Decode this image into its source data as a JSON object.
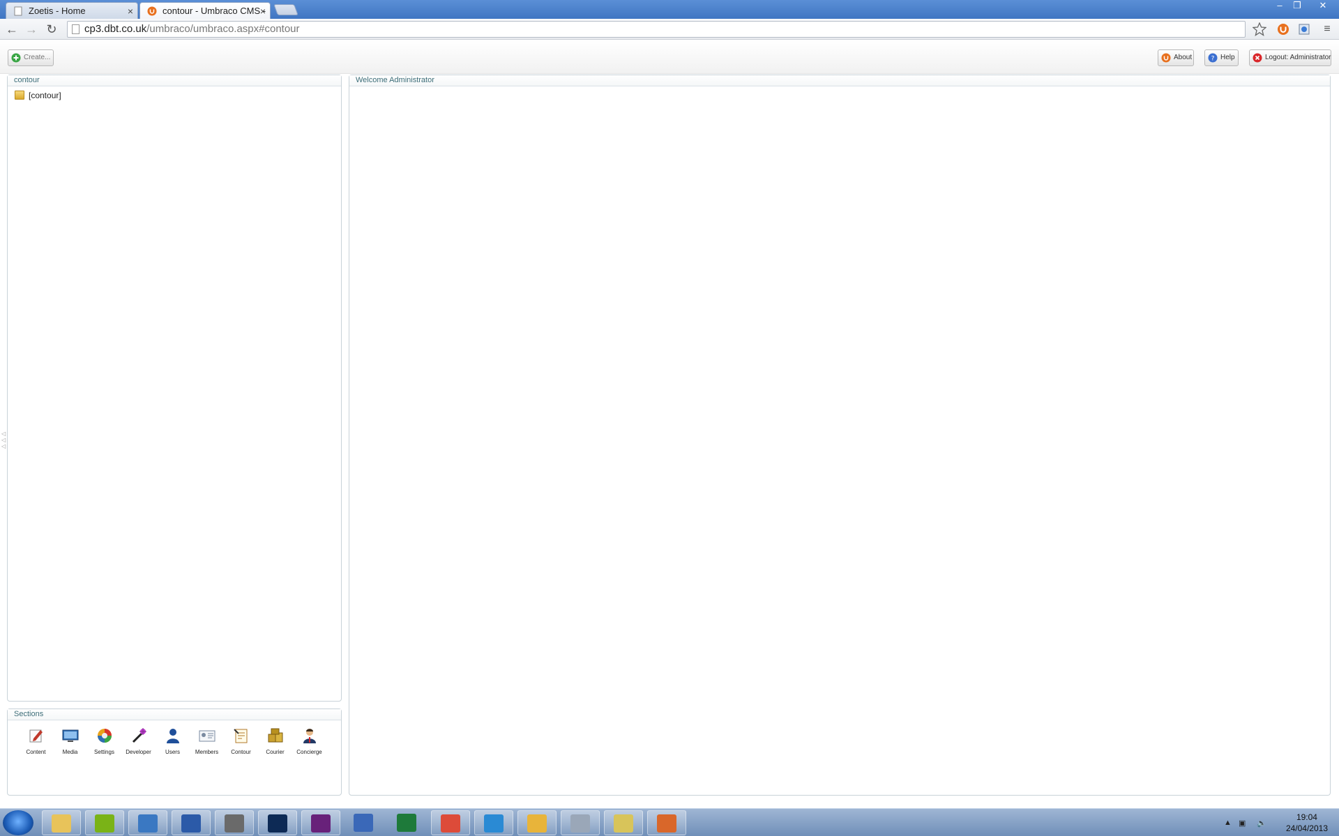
{
  "browser": {
    "tabs": [
      {
        "title": "Zoetis - Home",
        "active": false
      },
      {
        "title": "contour - Umbraco CMS -",
        "active": true
      }
    ],
    "url_host": "cp3.dbt.co.uk",
    "url_path": "/umbraco/umbraco.aspx#contour",
    "controls": {
      "minimize": "–",
      "restore": "❐",
      "close": "✕"
    }
  },
  "topbar": {
    "create_label": "Create...",
    "about_label": "About",
    "help_label": "Help",
    "logout_label": "Logout: Administrator"
  },
  "tree_panel": {
    "title": "contour",
    "nodes": [
      {
        "label": "[contour]"
      }
    ]
  },
  "sections_panel": {
    "title": "Sections",
    "items": [
      {
        "label": "Content",
        "icon": "pencil-icon",
        "color": "#c0392b"
      },
      {
        "label": "Media",
        "icon": "monitor-icon",
        "color": "#2f6fb3"
      },
      {
        "label": "Settings",
        "icon": "color-wheel-icon",
        "color": "#e8a21a"
      },
      {
        "label": "Developer",
        "icon": "wand-icon",
        "color": "#7a2f8a"
      },
      {
        "label": "Users",
        "icon": "user-icon",
        "color": "#1f4f9a"
      },
      {
        "label": "Members",
        "icon": "id-card-icon",
        "color": "#7a8aa0"
      },
      {
        "label": "Contour",
        "icon": "form-icon",
        "color": "#b07a2a"
      },
      {
        "label": "Courier",
        "icon": "boxes-icon",
        "color": "#c9a030"
      },
      {
        "label": "Concierge",
        "icon": "person-icon",
        "color": "#233a66"
      }
    ]
  },
  "main_panel": {
    "title": "Welcome Administrator"
  },
  "taskbar": {
    "time": "19:04",
    "date": "24/04/2013",
    "apps": [
      {
        "name": "explorer-icon",
        "color": "#e8c35a"
      },
      {
        "name": "spotify-icon",
        "color": "#7ab317"
      },
      {
        "name": "network-icon",
        "color": "#3a78c2"
      },
      {
        "name": "word-icon",
        "color": "#2b5aa8"
      },
      {
        "name": "archive-icon",
        "color": "#6a6a6a"
      },
      {
        "name": "photoshop-icon",
        "color": "#0d2a55"
      },
      {
        "name": "visual-studio-icon",
        "color": "#68217a"
      },
      {
        "name": "infinity-icon",
        "color": "#3a68b8"
      },
      {
        "name": "excel-icon",
        "color": "#1e7a3a"
      },
      {
        "name": "chrome-icon",
        "color": "#dd4b39"
      },
      {
        "name": "ie-icon",
        "color": "#2a8ad4"
      },
      {
        "name": "outlook-icon",
        "color": "#e8b43a"
      },
      {
        "name": "remote-desktop-icon",
        "color": "#9aa7b8"
      },
      {
        "name": "tools-icon",
        "color": "#d8c45a"
      },
      {
        "name": "file-transfer-icon",
        "color": "#d9672a"
      }
    ]
  }
}
